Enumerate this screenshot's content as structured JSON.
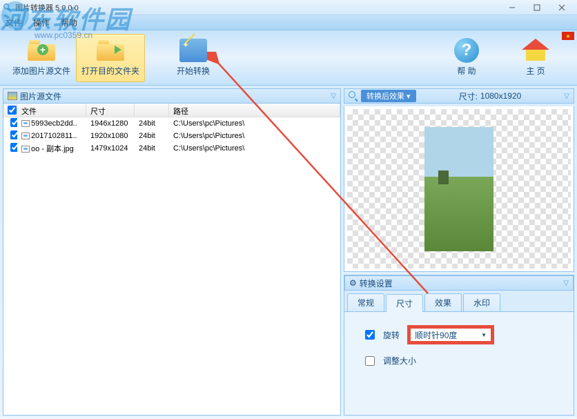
{
  "window": {
    "title": "图片转换器 5.0.0.0"
  },
  "watermark": {
    "main": "河东软件园",
    "sub": "www.pc0359.cn"
  },
  "menu": {
    "file": "文件",
    "operate": "操作",
    "help": "帮助"
  },
  "toolbar": {
    "add": "添加图片源文件",
    "open_folder": "打开目的文件夹",
    "start": "开始转换",
    "help": "帮 助",
    "home": "主 页"
  },
  "left": {
    "header": "图片源文件",
    "cols": {
      "chk": "",
      "file": "文件",
      "size": "尺寸",
      "bit": "",
      "path": "路径"
    },
    "rows": [
      {
        "file": "5993ecb2dd..",
        "size": "1946x1280",
        "bit": "24bit",
        "path": "C:\\Users\\pc\\Pictures\\"
      },
      {
        "file": "2017102811..",
        "size": "1920x1080",
        "bit": "24bit",
        "path": "C:\\Users\\pc\\Pictures\\"
      },
      {
        "file": "oo - 副本.jpg",
        "size": "1479x1024",
        "bit": "24bit",
        "path": "C:\\Users\\pc\\Pictures\\"
      }
    ]
  },
  "preview": {
    "tag": "转换后效果",
    "dim_label": "尺寸:",
    "dim": "1080x1920"
  },
  "settings": {
    "header": "转换设置",
    "tabs": {
      "general": "常规",
      "size": "尺寸",
      "effect": "效果",
      "watermark": "水印"
    },
    "rotate": "旋转",
    "rotate_value": "顺时针90度",
    "resize": "调整大小"
  }
}
